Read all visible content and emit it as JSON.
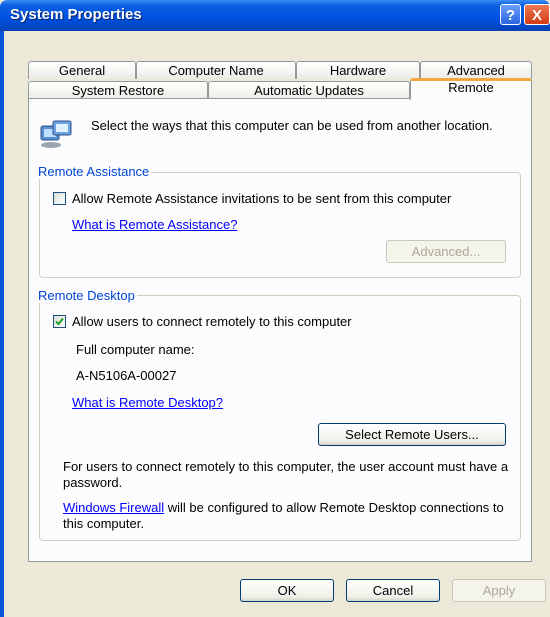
{
  "window": {
    "title": "System Properties"
  },
  "title_buttons": {
    "help": "?",
    "close": "X"
  },
  "tabs": {
    "row1": [
      "General",
      "Computer Name",
      "Hardware",
      "Advanced"
    ],
    "row2": [
      "System Restore",
      "Automatic Updates",
      "Remote"
    ],
    "active": "Remote"
  },
  "intro": {
    "text": "Select the ways that this computer can be used from another location."
  },
  "remote_assistance": {
    "group_label": "Remote Assistance",
    "checkbox_label": "Allow Remote Assistance invitations to be sent from this computer",
    "checked": false,
    "link": "What is Remote Assistance?",
    "advanced_button": "Advanced..."
  },
  "remote_desktop": {
    "group_label": "Remote Desktop",
    "checkbox_label": "Allow users to connect remotely to this computer",
    "checked": true,
    "full_name_label": "Full computer name:",
    "computer_name": "A-N5106A-00027",
    "link": "What is Remote Desktop?",
    "select_users_button": "Select Remote Users...",
    "password_note": "For users to connect remotely to this computer, the user account must have a password.",
    "firewall_link": "Windows Firewall",
    "firewall_note": " will be configured to allow Remote Desktop connections to this computer."
  },
  "footer_buttons": {
    "ok": "OK",
    "cancel": "Cancel",
    "apply": "Apply"
  }
}
